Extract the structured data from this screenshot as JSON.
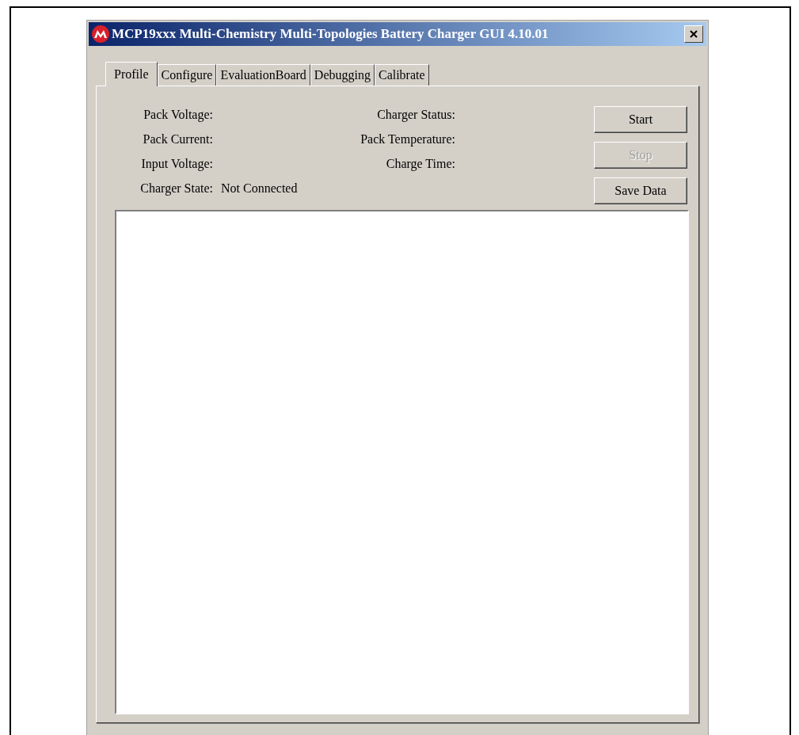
{
  "window": {
    "title": "MCP19xxx Multi-Chemistry Multi-Topologies Battery Charger GUI 4.10.01"
  },
  "tabs": [
    {
      "label": "Profile",
      "selected": true
    },
    {
      "label": "Configure",
      "selected": false
    },
    {
      "label": "EvaluationBoard",
      "selected": false
    },
    {
      "label": "Debugging",
      "selected": false
    },
    {
      "label": "Calibrate",
      "selected": false
    }
  ],
  "left_fields": [
    {
      "label": "Pack Voltage:"
    },
    {
      "label": "Pack Current:"
    },
    {
      "label": "Input Voltage:"
    },
    {
      "label": "Charger State:",
      "value": "Not Connected"
    }
  ],
  "right_fields": [
    {
      "label": "Charger Status:"
    },
    {
      "label": "Pack Temperature:"
    },
    {
      "label": "Charge Time:"
    }
  ],
  "buttons": [
    {
      "label": "Start",
      "disabled": false
    },
    {
      "label": "Stop",
      "disabled": true
    },
    {
      "label": "Save Data",
      "disabled": false
    }
  ]
}
